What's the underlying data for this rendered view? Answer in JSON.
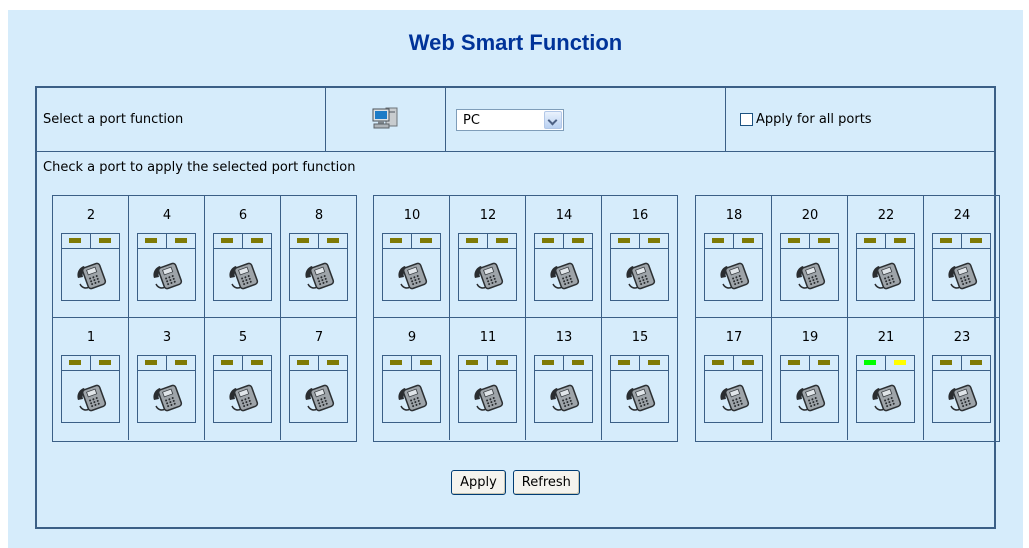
{
  "title": "Web Smart Function",
  "function_row": {
    "label": "Select a port function",
    "icon": "pc-icon",
    "selected_function": "PC",
    "apply_all_label": "Apply for all ports",
    "apply_all_checked": false
  },
  "check_hint": "Check a port to apply the selected port function",
  "colors": {
    "led_off": "#7f7a05",
    "led_green": "#00ff00",
    "led_yellow": "#ffff00",
    "panel_bg": "#d6ecfb",
    "border": "#3b5f86",
    "title": "#003399"
  },
  "port_groups": [
    {
      "top_row": [
        {
          "label": "2",
          "leds": [
            "off",
            "off"
          ]
        },
        {
          "label": "4",
          "leds": [
            "off",
            "off"
          ]
        },
        {
          "label": "6",
          "leds": [
            "off",
            "off"
          ]
        },
        {
          "label": "8",
          "leds": [
            "off",
            "off"
          ]
        }
      ],
      "bottom_row": [
        {
          "label": "1",
          "leds": [
            "off",
            "off"
          ]
        },
        {
          "label": "3",
          "leds": [
            "off",
            "off"
          ]
        },
        {
          "label": "5",
          "leds": [
            "off",
            "off"
          ]
        },
        {
          "label": "7",
          "leds": [
            "off",
            "off"
          ]
        }
      ]
    },
    {
      "top_row": [
        {
          "label": "10",
          "leds": [
            "off",
            "off"
          ]
        },
        {
          "label": "12",
          "leds": [
            "off",
            "off"
          ]
        },
        {
          "label": "14",
          "leds": [
            "off",
            "off"
          ]
        },
        {
          "label": "16",
          "leds": [
            "off",
            "off"
          ]
        }
      ],
      "bottom_row": [
        {
          "label": "9",
          "leds": [
            "off",
            "off"
          ]
        },
        {
          "label": "11",
          "leds": [
            "off",
            "off"
          ]
        },
        {
          "label": "13",
          "leds": [
            "off",
            "off"
          ]
        },
        {
          "label": "15",
          "leds": [
            "off",
            "off"
          ]
        }
      ]
    },
    {
      "top_row": [
        {
          "label": "18",
          "leds": [
            "off",
            "off"
          ]
        },
        {
          "label": "20",
          "leds": [
            "off",
            "off"
          ]
        },
        {
          "label": "22",
          "leds": [
            "off",
            "off"
          ]
        },
        {
          "label": "24",
          "leds": [
            "off",
            "off"
          ]
        }
      ],
      "bottom_row": [
        {
          "label": "17",
          "leds": [
            "off",
            "off"
          ]
        },
        {
          "label": "19",
          "leds": [
            "off",
            "off"
          ]
        },
        {
          "label": "21",
          "leds": [
            "green",
            "yellow"
          ]
        },
        {
          "label": "23",
          "leds": [
            "off",
            "off"
          ]
        }
      ]
    }
  ],
  "port_icon": "ip-phone-icon",
  "buttons": {
    "apply": "Apply",
    "refresh": "Refresh"
  }
}
